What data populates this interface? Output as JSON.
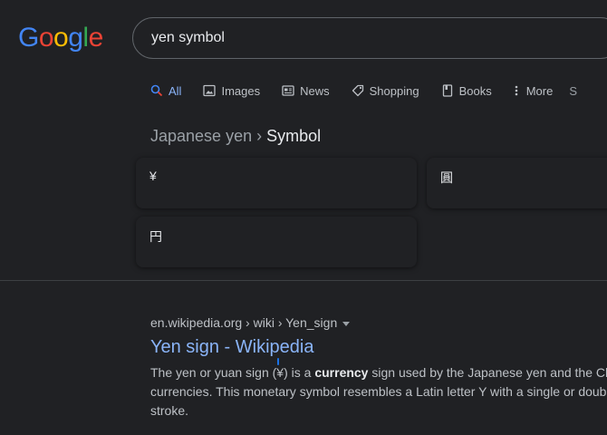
{
  "logo": {
    "letters": [
      "G",
      "o",
      "o",
      "g",
      "l",
      "e"
    ],
    "colors": [
      "#4285f4",
      "#ea4335",
      "#fbbc05",
      "#4285f4",
      "#34a853",
      "#ea4335"
    ]
  },
  "search": {
    "query": "yen symbol"
  },
  "tabs": {
    "all": "All",
    "images": "Images",
    "news": "News",
    "shopping": "Shopping",
    "books": "Books",
    "more": "More",
    "cut": "S"
  },
  "breadcrumb": {
    "parent": "Japanese yen",
    "separator": "›",
    "current": "Symbol"
  },
  "symbols": {
    "yen": "¥",
    "en_kanji": "円",
    "third": "圓"
  },
  "result": {
    "cite": "en.wikipedia.org › wiki › Yen_sign",
    "title": "Yen sign - Wikipedia",
    "snippet_a": "The yen or yuan sign (",
    "snippet_sym": "¥",
    "snippet_b": ") is a ",
    "snippet_bold": "currency",
    "snippet_c": " sign used by the Japanese yen and the Chin",
    "snippet_line2": "currencies. This monetary symbol resembles a Latin letter Y with a single or doub",
    "snippet_line3": "stroke."
  },
  "colors": {
    "background": "#202124",
    "link": "#8ab4f8",
    "text": "#bdc1c6",
    "strong": "#e8eaed"
  }
}
